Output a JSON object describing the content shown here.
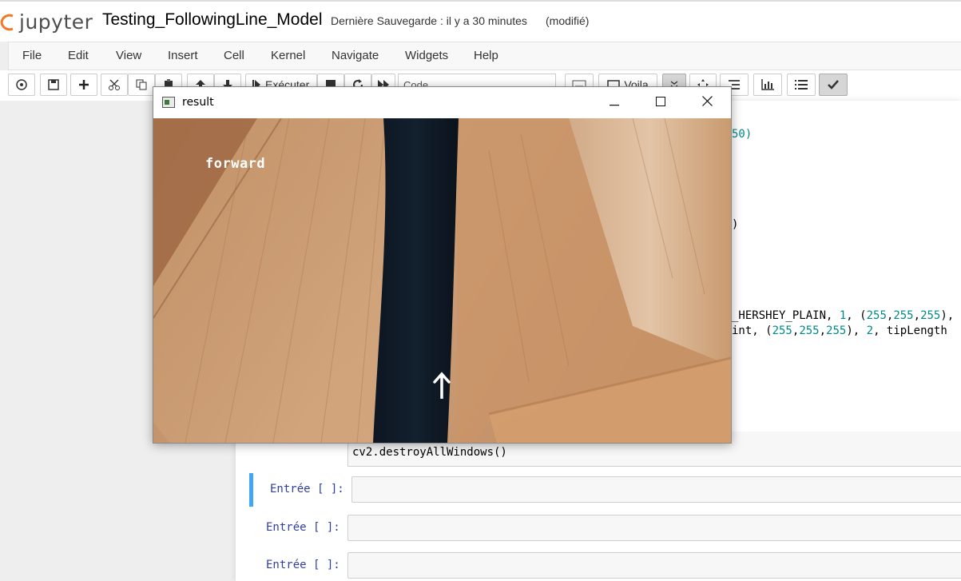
{
  "header": {
    "logo_text": "jupyter",
    "notebook_title": "Testing_FollowingLine_Model",
    "save_status": "Dernière Sauvegarde : il y a 30 minutes",
    "modified_flag": "(modifié)"
  },
  "menu": {
    "items": [
      "File",
      "Edit",
      "View",
      "Insert",
      "Cell",
      "Kernel",
      "Navigate",
      "Widgets",
      "Help"
    ]
  },
  "toolbar": {
    "run_label": "Exécuter",
    "cell_type_value": "Code",
    "voila_label": "Voila",
    "icons": [
      "command-palette-icon",
      "save-icon",
      "add-cell-icon",
      "cut-icon",
      "copy-icon",
      "paste-icon",
      "move-up-icon",
      "move-down-icon",
      "run-icon",
      "stop-icon",
      "restart-icon",
      "fast-forward-icon",
      "keyboard-icon",
      "voila-icon",
      "collapse-icon",
      "move-icon",
      "list-icon",
      "chart-icon",
      "bulleted-list-icon",
      "check-icon"
    ]
  },
  "code": {
    "line1_tail": "50)",
    "line2_tail": ")",
    "line3_prefix": "_HERSHEY_PLAIN, ",
    "line3_n1": "1",
    "line3_mid": ", (",
    "line3_c1": "255",
    "line3_c2": "255",
    "line3_c3": "255",
    "line3_end": "),",
    "line4_prefix": "int, (",
    "line4_c1": "255",
    "line4_c2": "255",
    "line4_c3": "255",
    "line4_mid": "), ",
    "line4_n": "2",
    "line4_end": ", tipLength",
    "last_line": "cv2.destroyAllWindows()"
  },
  "cells": [
    {
      "prompt": "Entrée [ ]:",
      "selected": true
    },
    {
      "prompt": "Entrée [ ]:",
      "selected": false
    },
    {
      "prompt": "Entrée [ ]:",
      "selected": false
    }
  ],
  "result_window": {
    "title": "result",
    "overlay_text": "forward",
    "arrow_direction": "up"
  },
  "colors": {
    "jupyter_orange": "#f37726",
    "selected_cell_border": "#42a5f5",
    "prompt_blue": "#303f9f",
    "number_green": "#008000"
  }
}
